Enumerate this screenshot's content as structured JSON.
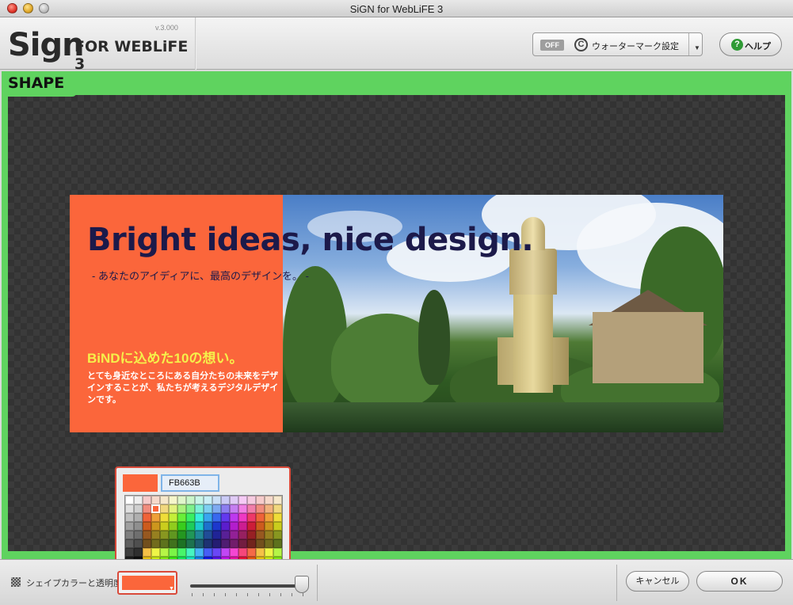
{
  "window": {
    "title": "SiGN for WebLiFE 3"
  },
  "header": {
    "logo_sign": "Sign",
    "logo_for": "FOR WEBLiFE 3",
    "version": "v.3.000",
    "watermark": {
      "state": "OFF",
      "icon": "copyright-icon",
      "label": "ウォーターマーク設定"
    },
    "help": {
      "icon": "help-icon",
      "label": "ヘルプ"
    }
  },
  "shape_panel": {
    "tab_label": "SHAPE",
    "accent_color": "#5fd35f"
  },
  "banner": {
    "headline": "Bright ideas, nice design.",
    "subheadline": "- あなたのアイディアに、最高のデザインを。 -",
    "tagline": "BiNDに込めた10の想い。",
    "body": "とても身近なところにある自分たちの未来をデザインすることが、私たちが考えるデジタルデザインです。",
    "shape_color": "#fb663b"
  },
  "color_picker": {
    "hex_value": "FB663B",
    "selected_color": "#fb663b"
  },
  "bottom_bar": {
    "shape_color_label": "シェイプカラーと透明度",
    "opacity_percent": 100,
    "cancel_label": "キャンセル",
    "ok_label": "OK"
  }
}
